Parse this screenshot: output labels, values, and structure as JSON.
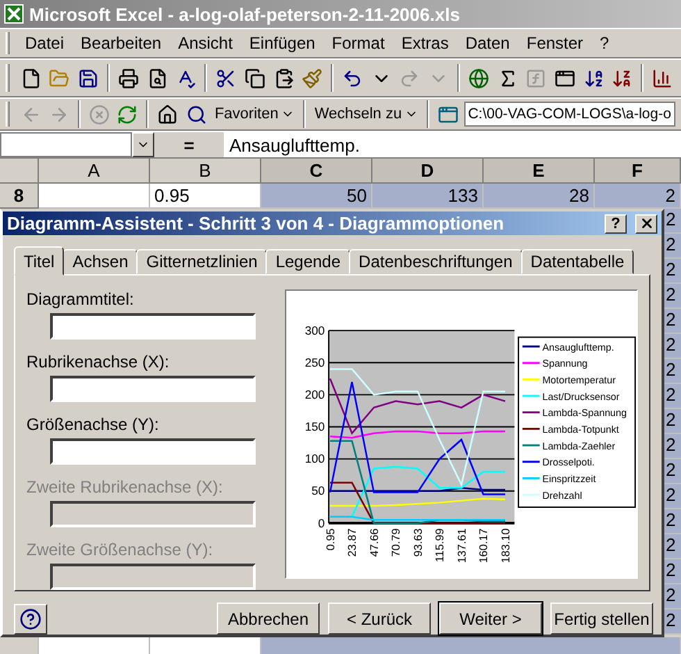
{
  "window": {
    "title": "Microsoft Excel - a-log-olaf-peterson-2-11-2006.xls"
  },
  "menu": [
    "Datei",
    "Bearbeiten",
    "Ansicht",
    "Einfügen",
    "Format",
    "Extras",
    "Daten",
    "Fenster",
    "?"
  ],
  "web_toolbar": {
    "favorites": "Favoriten",
    "goto": "Wechseln zu",
    "address": "C:\\00-VAG-COM-LOGS\\a-log-o"
  },
  "formula_bar": {
    "equals": "=",
    "content": "Ansauglufttemp."
  },
  "sheet": {
    "columns": [
      {
        "label": "A",
        "selected": false
      },
      {
        "label": "B",
        "selected": false
      },
      {
        "label": "C",
        "selected": true
      },
      {
        "label": "D",
        "selected": true
      },
      {
        "label": "E",
        "selected": true
      },
      {
        "label": "F",
        "selected": true
      }
    ],
    "row": {
      "header": "8",
      "cells": [
        {
          "selected": false
        },
        {
          "value": "0.95",
          "selected": false
        },
        {
          "value": "50",
          "selected": true
        },
        {
          "value": "133",
          "selected": true
        },
        {
          "value": "28",
          "selected": true
        },
        {
          "value": "2",
          "selected": true
        }
      ]
    },
    "column_f_cells": [
      "2",
      "2",
      "2",
      "2",
      "2",
      "2",
      "2",
      "2",
      "2",
      "2",
      "2",
      "2",
      "2",
      "2",
      "2",
      "2",
      "2"
    ]
  },
  "dialog": {
    "title": "Diagramm-Assistent - Schritt 3 von 4 - Diagrammoptionen",
    "help": "?",
    "tabs": [
      {
        "label": "Titel",
        "selected": true
      },
      {
        "label": "Achsen",
        "selected": false
      },
      {
        "label": "Gitternetzlinien",
        "selected": false
      },
      {
        "label": "Legende",
        "selected": false
      },
      {
        "label": "Datenbeschriftungen",
        "selected": false
      },
      {
        "label": "Datentabelle",
        "selected": false
      }
    ],
    "fields": [
      {
        "label": "Diagrammtitel:",
        "disabled": false
      },
      {
        "label": "Rubrikenachse (X):",
        "disabled": false
      },
      {
        "label": "Größenachse (Y):",
        "disabled": false
      },
      {
        "label": "Zweite Rubrikenachse (X):",
        "disabled": true
      },
      {
        "label": "Zweite Größenachse (Y):",
        "disabled": true
      }
    ],
    "chart_data": {
      "type": "line",
      "grid": true,
      "legend": true,
      "categories": [
        "0.95",
        "23.87",
        "47.66",
        "70.79",
        "93.63",
        "115.99",
        "137.61",
        "160.17",
        "183.10"
      ],
      "ylim": [
        0,
        300
      ],
      "yticks": [
        0,
        50,
        100,
        150,
        200,
        250,
        300
      ],
      "series": [
        {
          "name": "Ansauglufttemp.",
          "color": "#000080",
          "values": [
            50,
            50,
            50,
            50,
            50,
            50,
            55,
            52,
            52
          ]
        },
        {
          "name": "Spannung",
          "color": "#ff00ff",
          "values": [
            135,
            133,
            140,
            143,
            143,
            140,
            140,
            143,
            143
          ]
        },
        {
          "name": "Motortemperatur",
          "color": "#ffff00",
          "values": [
            27,
            27,
            27,
            28,
            30,
            32,
            35,
            38,
            37
          ]
        },
        {
          "name": "Last/Drucksensor",
          "color": "#00ffff",
          "values": [
            10,
            10,
            85,
            88,
            85,
            55,
            55,
            80,
            80
          ]
        },
        {
          "name": "Lambda-Spannung",
          "color": "#800080",
          "values": [
            225,
            140,
            180,
            190,
            185,
            190,
            180,
            200,
            190
          ]
        },
        {
          "name": "Lambda-Totpunkt",
          "color": "#800000",
          "values": [
            63,
            63,
            0,
            0,
            0,
            0,
            0,
            0,
            0
          ]
        },
        {
          "name": "Lambda-Zaehler",
          "color": "#008080",
          "values": [
            128,
            128,
            0,
            0,
            0,
            5,
            5,
            3,
            3
          ]
        },
        {
          "name": "Drosselpoti.",
          "color": "#0000ff",
          "values": [
            48,
            220,
            48,
            48,
            48,
            100,
            130,
            45,
            45
          ]
        },
        {
          "name": "Einspritzzeit",
          "color": "#00ccff",
          "values": [
            10,
            10,
            5,
            5,
            5,
            5,
            5,
            5,
            5
          ]
        },
        {
          "name": "Drehzahl",
          "color": "#ccffff",
          "values": [
            240,
            240,
            200,
            205,
            205,
            130,
            60,
            205,
            205
          ]
        }
      ]
    },
    "buttons": [
      {
        "label": "Abbrechen",
        "default": false
      },
      {
        "label": "< Zurück",
        "default": false
      },
      {
        "label": "Weiter >",
        "default": true
      },
      {
        "label": "Fertig stellen",
        "default": false
      }
    ]
  }
}
